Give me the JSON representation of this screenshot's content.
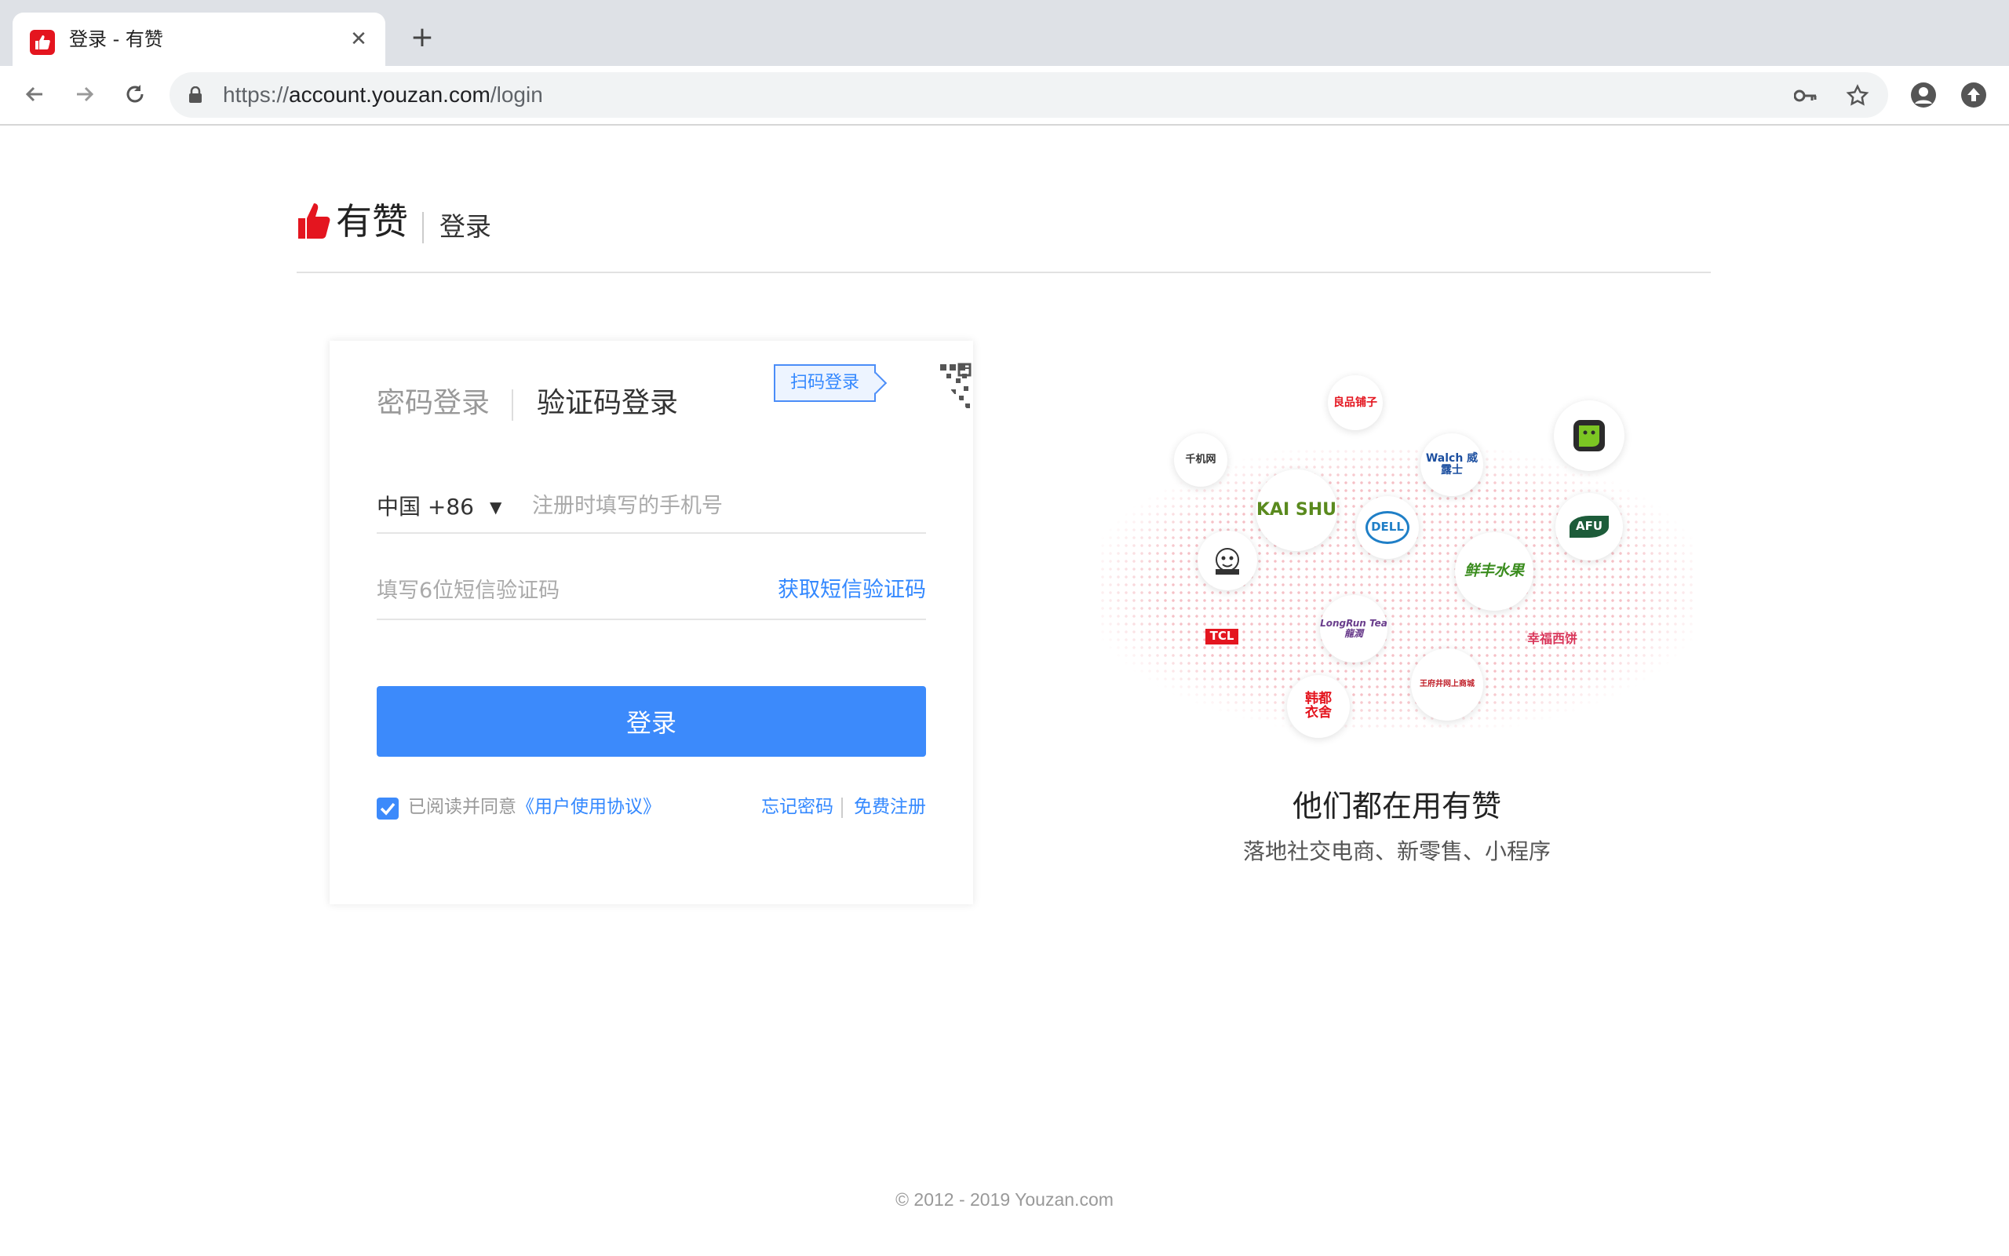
{
  "browser": {
    "tab_title": "登录 - 有赞",
    "url_prefix": "https://",
    "url_host": "account.youzan.com",
    "url_path": "/login",
    "accent": "#e4151f"
  },
  "header": {
    "brand_name": "有赞",
    "subtitle": "登录"
  },
  "login": {
    "tab_password": "密码登录",
    "tab_sms": "验证码登录",
    "qr_tip": "扫码登录",
    "country_code": "中国 +86",
    "phone_placeholder": "注册时填写的手机号",
    "code_placeholder": "填写6位短信验证码",
    "get_code": "获取短信验证码",
    "submit": "登录",
    "agree_prefix": "已阅读并同意",
    "agree_link": "《用户使用协议》",
    "agreed": true,
    "forgot": "忘记密码",
    "register": "免费注册",
    "primary_color": "#3c8afb",
    "link_color": "#3388ff"
  },
  "showcase": {
    "brands": [
      {
        "name": "良品铺子",
        "color": "#e4151f"
      },
      {
        "name": "千机网",
        "color": "#333333"
      },
      {
        "name": "KAI SHU",
        "color": "#5a8a1e"
      },
      {
        "name": "Walch 威露士",
        "color": "#1c4fa0"
      },
      {
        "name": "DELL",
        "color": "#1f7fc7"
      },
      {
        "name": "AFU",
        "color": "#1d5c3a"
      },
      {
        "name": "鲜丰水果",
        "color": "#3a8c1e"
      },
      {
        "name": "TCL",
        "color": "#e4151f"
      },
      {
        "name": "LongRun Tea 龍潤",
        "color": "#6a3d8c"
      },
      {
        "name": "幸福西饼",
        "color": "#d9365a"
      },
      {
        "name": "韩都衣舍",
        "color": "#e4151f"
      },
      {
        "name": "王府井网上商城",
        "color": "#c0202a"
      }
    ],
    "headline": "他们都在用有赞",
    "subline": "落地社交电商、新零售、小程序"
  },
  "footer": {
    "copyright": "© 2012 - 2019 Youzan.com"
  }
}
